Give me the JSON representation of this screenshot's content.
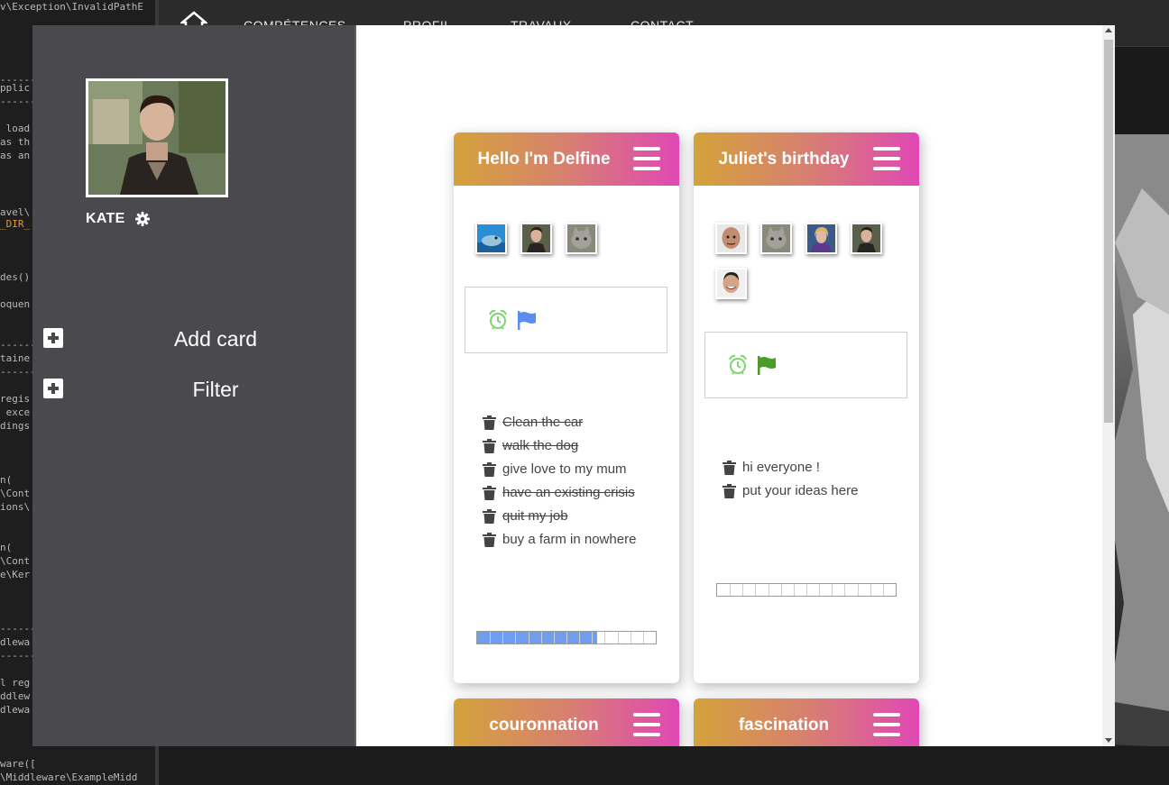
{
  "background": {
    "code_lines": [
      "v\\Exception\\InvalidPathE",
      "--------",
      "pplic",
      "--------",
      " load",
      "as th",
      "as an",
      "avel\\",
      "_DIR_",
      "des()",
      "oquen",
      "--------",
      "taine",
      "--------",
      "regis",
      " exce",
      "dings",
      "n(",
      "\\Cont",
      "ions\\",
      "n(",
      "\\Cont",
      "e\\Ker",
      "--------",
      "dlewa",
      "--------",
      "l reg",
      "ddlew",
      "dlewa",
      "ware([",
      "\\Middleware\\ExampleMidd"
    ],
    "nav_links": [
      "COMPÉTENCES",
      "PROFIL",
      "TRAVAUX",
      "CONTACT"
    ],
    "home_icon": "home-icon"
  },
  "sidebar": {
    "username": "KATE",
    "settings_icon": "gear-icon",
    "actions": [
      {
        "label": "Add card",
        "icon": "plus-square-icon"
      },
      {
        "label": "Filter",
        "icon": "plus-square-icon"
      }
    ]
  },
  "colors": {
    "sidebar_bg": "#4a494e",
    "header_gradient": [
      "#d4a23a",
      "#d78070",
      "#e048b4"
    ],
    "alarm_green": "#7ed56f",
    "flag_blue": "#5b8def",
    "flag_green": "#4c9a2a",
    "progress_blue": "#6f9ef0"
  },
  "cards": [
    {
      "title": "Hello I'm Delfine",
      "members": [
        "dolphin",
        "young-man",
        "cat"
      ],
      "flag_color": "blue",
      "todos": [
        {
          "text": "Clean the car",
          "done": true
        },
        {
          "text": "walk the dog",
          "done": true
        },
        {
          "text": "give love to my mum",
          "done": false
        },
        {
          "text": "have an existing crisis",
          "done": true
        },
        {
          "text": "quit my job",
          "done": true
        },
        {
          "text": "buy a farm in nowhere",
          "done": false
        }
      ],
      "progress": 0.67
    },
    {
      "title": "Juliet's birthday",
      "members": [
        "bald-man",
        "cat",
        "blonde-man",
        "young-man",
        "smiling-man"
      ],
      "flag_color": "green",
      "todos": [
        {
          "text": "hi everyone !",
          "done": false
        },
        {
          "text": "put your ideas here",
          "done": false
        }
      ],
      "progress": 0
    },
    {
      "title": "couronnation"
    },
    {
      "title": "fascination"
    }
  ]
}
